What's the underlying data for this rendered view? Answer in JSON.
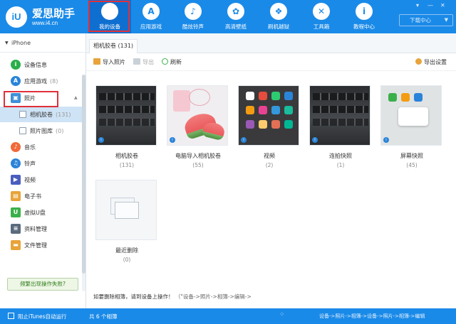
{
  "app": {
    "name": "爱思助手",
    "url": "www.i4.cn",
    "logo_text": "iU",
    "download_label": "下载中心"
  },
  "nav": {
    "items": [
      {
        "label": "我的设备",
        "icon": "apple-icon",
        "glyph": ""
      },
      {
        "label": "应用游戏",
        "icon": "app-store-icon",
        "glyph": "A"
      },
      {
        "label": "酷炫铃声",
        "icon": "bell-icon",
        "glyph": "♪"
      },
      {
        "label": "高清壁纸",
        "icon": "flower-icon",
        "glyph": "✿"
      },
      {
        "label": "刷机越狱",
        "icon": "dropbox-icon",
        "glyph": "❖"
      },
      {
        "label": "工具箱",
        "icon": "tools-icon",
        "glyph": "✕"
      },
      {
        "label": "教程中心",
        "icon": "info-icon",
        "glyph": "i"
      }
    ]
  },
  "sidebar": {
    "device": "iPhone",
    "items": [
      {
        "label": "设备信息",
        "count": "",
        "icon": "info-circle-icon",
        "color": "#2bae4a"
      },
      {
        "label": "应用游戏",
        "count": "(8)",
        "icon": "app-icon",
        "color": "#2a84d9"
      },
      {
        "label": "照片",
        "count": "",
        "icon": "photo-icon",
        "color": "#3e8fd8"
      },
      {
        "label": "相机胶卷",
        "count": "(131)",
        "icon": "camera-roll-icon",
        "color": ""
      },
      {
        "label": "照片图库",
        "count": "(0)",
        "icon": "photo-library-icon",
        "color": ""
      },
      {
        "label": "音乐",
        "count": "",
        "icon": "music-icon",
        "color": "#f06a3a"
      },
      {
        "label": "铃声",
        "count": "",
        "icon": "ringtone-icon",
        "color": "#2a84d9"
      },
      {
        "label": "视频",
        "count": "",
        "icon": "video-icon",
        "color": "#4a5dbf"
      },
      {
        "label": "电子书",
        "count": "",
        "icon": "ebook-icon",
        "color": "#e8a43a"
      },
      {
        "label": "虚拟U盘",
        "count": "",
        "icon": "usb-icon",
        "color": "#3bb04a"
      },
      {
        "label": "资料管理",
        "count": "",
        "icon": "data-icon",
        "color": "#5a6b7d"
      },
      {
        "label": "文件管理",
        "count": "",
        "icon": "folder-icon",
        "color": "#e8a43a"
      }
    ],
    "fail_button": "频繁出现操作失败?"
  },
  "main": {
    "tab": "相机胶卷 (131)",
    "toolbar": {
      "import": "导入照片",
      "export": "导出",
      "refresh": "刷新",
      "export_settings": "导出设置"
    },
    "albums": [
      {
        "name": "相机胶卷",
        "count": "(131)"
      },
      {
        "name": "电脑导入相机胶卷",
        "count": "(55)"
      },
      {
        "name": "视频",
        "count": "(2)"
      },
      {
        "name": "连拍快照",
        "count": "(1)"
      },
      {
        "name": "屏幕快照",
        "count": "(45)"
      },
      {
        "name": "最近删除",
        "count": "(0)"
      }
    ],
    "notice": "如要删除相簿，请到设备上操作！",
    "notice_path": "（\"设备->照片->相簿->编辑->"
  },
  "status": {
    "itunes": "阻止iTunes自动运行",
    "count": "共 6 个相簿",
    "path": "设备->照片->相簿->设备->照片->相簿->编辑"
  }
}
